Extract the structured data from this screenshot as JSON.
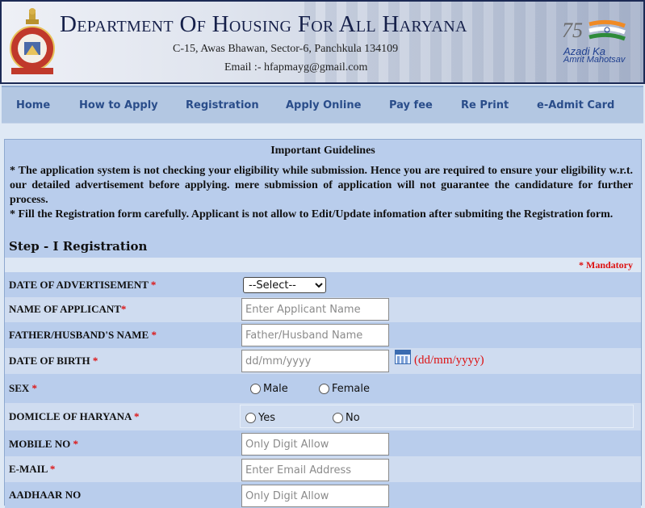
{
  "header": {
    "title": "Department Of Housing For All Haryana",
    "address": "C-15, Awas Bhawan, Sector-6, Panchkula 134109",
    "email": "Email :- hfapmayg@gmail.com",
    "logo_right": {
      "line1": "Azadi Ka",
      "line2": "Amrit Mahotsav",
      "number": "75"
    }
  },
  "nav": {
    "items": [
      "Home",
      "How to Apply",
      "Registration",
      "Apply Online",
      "Pay fee",
      "Re Print",
      "e-Admit Card"
    ]
  },
  "guidelines": {
    "title": "Important Guidelines",
    "point1": "*  The application system is not checking your eligibility while submission. Hence you are required to ensure your eligibility w.r.t. our detailed advertisement before applying. mere submission of application will not guarantee the candidature for further  process.",
    "point2": "*   Fill the Registration form carefully. Applicant is not allow to Edit/Update infomation after submiting the Registration form."
  },
  "form": {
    "step_title": "Step - I Registration",
    "mandatory_note": "* Mandatory",
    "date_of_advertisement": {
      "label": "DATE OF ADVERTISEMENT",
      "selected": "--Select--"
    },
    "name_of_applicant": {
      "label": "NAME OF APPLICANT",
      "placeholder": "Enter Applicant Name"
    },
    "father_husband_name": {
      "label": "FATHER/HUSBAND'S NAME",
      "placeholder": "Father/Husband Name"
    },
    "date_of_birth": {
      "label": "DATE OF BIRTH",
      "placeholder": "dd/mm/yyyy",
      "format_hint": "(dd/mm/yyyy)"
    },
    "sex": {
      "label": "SEX",
      "options": [
        "Male",
        "Female"
      ]
    },
    "domicile": {
      "label": "DOMICLE OF HARYANA",
      "options": [
        "Yes",
        "No"
      ]
    },
    "mobile_no": {
      "label": "MOBILE NO",
      "placeholder": "Only Digit Allow"
    },
    "email": {
      "label": "E-MAIL",
      "placeholder": "Enter Email Address"
    },
    "aadhaar_no": {
      "label": "AADHAAR NO",
      "placeholder": "Only Digit Allow"
    },
    "required_marker": "*"
  },
  "colors": {
    "accent": "#2a4d8a",
    "mandatory": "#dd1111",
    "panel": "#b9cdec"
  }
}
